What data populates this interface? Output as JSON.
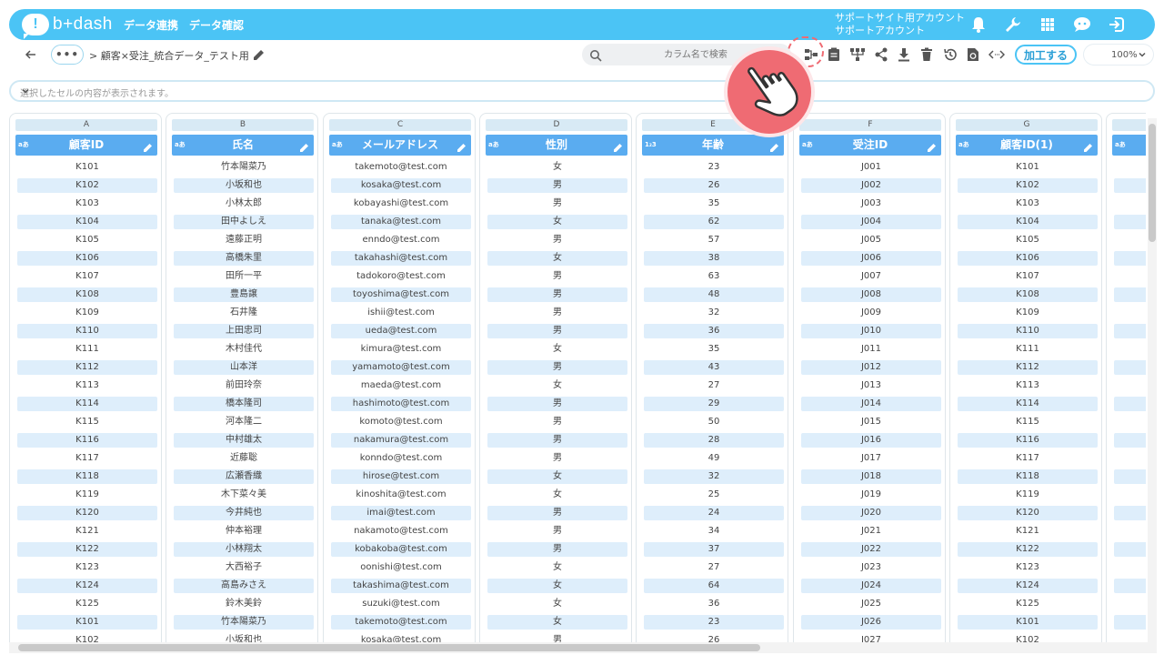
{
  "app": {
    "logo_text": "b+dash",
    "logo_mark": "!",
    "nav": [
      "データ連携",
      "データ確認"
    ],
    "account_line1": "サポートサイト用アカウント",
    "account_line2": "サポートアカウント"
  },
  "toolbar": {
    "breadcrumb": "> 顧客×受注_統合データ_テスト用",
    "more_label": "•••",
    "search_placeholder": "カラム名で検索",
    "process_button": "加工する",
    "zoom": "100%"
  },
  "cellbar": {
    "placeholder": "選択したセルの内容が表示されます。"
  },
  "colors": {
    "brand": "#4bc4f5",
    "header": "#5aacf0",
    "row_alt": "#deeefb",
    "pointer": "#ef6b73"
  },
  "columns": [
    {
      "letter": "A",
      "type": "aあ",
      "name": "顧客ID",
      "values": [
        "K101",
        "K102",
        "K103",
        "K104",
        "K105",
        "K106",
        "K107",
        "K108",
        "K109",
        "K110",
        "K111",
        "K112",
        "K113",
        "K114",
        "K115",
        "K116",
        "K117",
        "K118",
        "K119",
        "K120",
        "K121",
        "K122",
        "K123",
        "K124",
        "K125",
        "K101",
        "K102"
      ]
    },
    {
      "letter": "B",
      "type": "aあ",
      "name": "氏名",
      "values": [
        "竹本陽菜乃",
        "小坂和也",
        "小林太郎",
        "田中よしえ",
        "遠藤正明",
        "高橋朱里",
        "田所一平",
        "豊島譲",
        "石井隆",
        "上田忠司",
        "木村佳代",
        "山本洋",
        "前田玲奈",
        "橋本隆司",
        "河本隆二",
        "中村雄太",
        "近藤聡",
        "広瀬香織",
        "木下菜々美",
        "今井純也",
        "仲本裕理",
        "小林翔太",
        "大西裕子",
        "高島みさえ",
        "鈴木美鈴",
        "竹本陽菜乃",
        "小坂和也"
      ]
    },
    {
      "letter": "C",
      "type": "aあ",
      "name": "メールアドレス",
      "values": [
        "takemoto@test.com",
        "kosaka@test.com",
        "kobayashi@test.com",
        "tanaka@test.com",
        "enndo@test.com",
        "takahashi@test.com",
        "tadokoro@test.com",
        "toyoshima@test.com",
        "ishii@test.com",
        "ueda@test.com",
        "kimura@test.com",
        "yamamoto@test.com",
        "maeda@test.com",
        "hashimoto@test.com",
        "komoto@test.com",
        "nakamura@test.com",
        "konndo@test.com",
        "hirose@test.com",
        "kinoshita@test.com",
        "imai@test.com",
        "nakamoto@test.com",
        "kobakoba@test.com",
        "oonishi@test.com",
        "takashima@test.com",
        "suzuki@test.com",
        "takemoto@test.com",
        "kosaka@test.com"
      ]
    },
    {
      "letter": "D",
      "type": "aあ",
      "name": "性別",
      "values": [
        "女",
        "男",
        "男",
        "女",
        "男",
        "女",
        "男",
        "男",
        "男",
        "男",
        "女",
        "男",
        "女",
        "男",
        "男",
        "男",
        "男",
        "女",
        "女",
        "男",
        "男",
        "男",
        "女",
        "女",
        "女",
        "女",
        "男"
      ]
    },
    {
      "letter": "E",
      "type": "1₂3",
      "name": "年齢",
      "values": [
        "23",
        "26",
        "35",
        "62",
        "57",
        "38",
        "63",
        "48",
        "32",
        "36",
        "35",
        "43",
        "27",
        "29",
        "50",
        "28",
        "49",
        "32",
        "25",
        "24",
        "34",
        "37",
        "27",
        "64",
        "36",
        "23",
        "26"
      ]
    },
    {
      "letter": "F",
      "type": "aあ",
      "name": "受注ID",
      "values": [
        "J001",
        "J002",
        "J003",
        "J004",
        "J005",
        "J006",
        "J007",
        "J008",
        "J009",
        "J010",
        "J011",
        "J012",
        "J013",
        "J014",
        "J015",
        "J016",
        "J017",
        "J018",
        "J019",
        "J020",
        "J021",
        "J022",
        "J023",
        "J024",
        "J025",
        "J026",
        "J027"
      ]
    },
    {
      "letter": "G",
      "type": "aあ",
      "name": "顧客ID(1)",
      "values": [
        "K101",
        "K102",
        "K103",
        "K104",
        "K105",
        "K106",
        "K107",
        "K108",
        "K109",
        "K110",
        "K111",
        "K112",
        "K113",
        "K114",
        "K115",
        "K116",
        "K117",
        "K118",
        "K119",
        "K120",
        "K121",
        "K122",
        "K123",
        "K124",
        "K125",
        "K101",
        "K102"
      ]
    },
    {
      "letter": "",
      "type": "aあ",
      "name": "",
      "values": []
    }
  ]
}
